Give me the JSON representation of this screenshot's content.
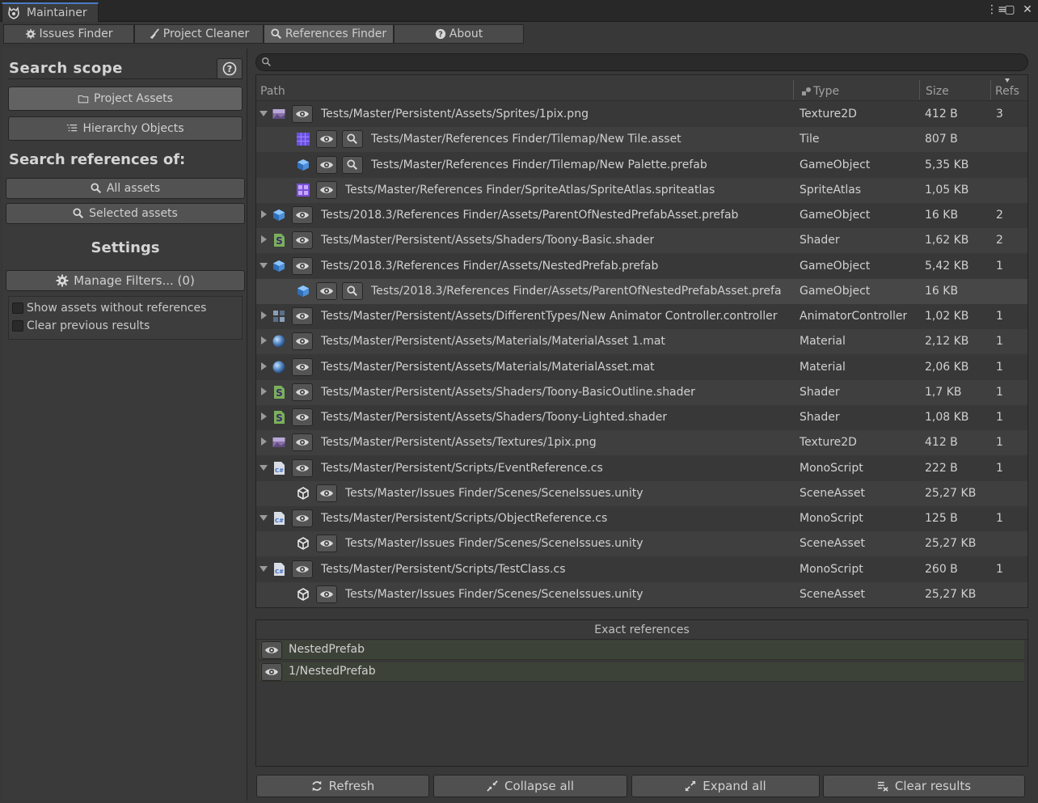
{
  "window": {
    "title": "Maintainer"
  },
  "tabs": [
    {
      "label": "Issues Finder",
      "icon": "bug-gear-icon"
    },
    {
      "label": "Project Cleaner",
      "icon": "broom-icon"
    },
    {
      "label": "References Finder",
      "icon": "search-icon",
      "active": true
    },
    {
      "label": "About",
      "icon": "help-icon"
    }
  ],
  "left": {
    "search_scope_title": "Search scope",
    "project_assets": "Project Assets",
    "hierarchy_objects": "Hierarchy Objects",
    "search_refs_title": "Search references of:",
    "all_assets": "All assets",
    "selected_assets": "Selected assets",
    "settings_title": "Settings",
    "manage_filters": "Manage Filters... (0)",
    "opt_show_without_refs": "Show assets without references",
    "opt_clear_previous": "Clear previous results"
  },
  "search": {
    "value": "",
    "placeholder": ""
  },
  "table": {
    "headers": {
      "path": "Path",
      "type": "Type",
      "size": "Size",
      "refs": "Refs"
    },
    "rows": [
      {
        "path": "Tests/Master/Persistent/Assets/Sprites/1pix.png",
        "type": "Texture2D",
        "size": "412 B",
        "refs": "3",
        "level": 0,
        "expand": "open",
        "icon": "texture-icon",
        "mag": false
      },
      {
        "path": "Tests/Master/References Finder/Tilemap/New Tile.asset",
        "type": "Tile",
        "size": "807 B",
        "refs": "",
        "level": 1,
        "expand": "none",
        "icon": "tile-icon",
        "mag": true
      },
      {
        "path": "Tests/Master/References Finder/Tilemap/New Palette.prefab",
        "type": "GameObject",
        "size": "5,35 KB",
        "refs": "",
        "level": 1,
        "expand": "none",
        "icon": "prefab-icon",
        "mag": true
      },
      {
        "path": "Tests/Master/References Finder/SpriteAtlas/SpriteAtlas.spriteatlas",
        "type": "SpriteAtlas",
        "size": "1,05 KB",
        "refs": "",
        "level": 1,
        "expand": "none",
        "icon": "sprite-atlas-icon",
        "mag": false
      },
      {
        "path": "Tests/2018.3/References Finder/Assets/ParentOfNestedPrefabAsset.prefab",
        "type": "GameObject",
        "size": "16 KB",
        "refs": "2",
        "level": 0,
        "expand": "closed",
        "icon": "prefab-icon",
        "mag": false
      },
      {
        "path": "Tests/Master/Persistent/Assets/Shaders/Toony-Basic.shader",
        "type": "Shader",
        "size": "1,62 KB",
        "refs": "2",
        "level": 0,
        "expand": "closed",
        "icon": "shader-icon",
        "mag": false
      },
      {
        "path": "Tests/2018.3/References Finder/Assets/NestedPrefab.prefab",
        "type": "GameObject",
        "size": "5,42 KB",
        "refs": "1",
        "level": 0,
        "expand": "open",
        "icon": "prefab-icon",
        "mag": false
      },
      {
        "path": "Tests/2018.3/References Finder/Assets/ParentOfNestedPrefabAsset.prefa",
        "type": "GameObject",
        "size": "16 KB",
        "refs": "",
        "level": 1,
        "expand": "none",
        "icon": "prefab-icon",
        "mag": true,
        "selected": true
      },
      {
        "path": "Tests/Master/Persistent/Assets/DifferentTypes/New Animator Controller.controller",
        "type": "AnimatorController",
        "size": "1,02 KB",
        "refs": "1",
        "level": 0,
        "expand": "closed",
        "icon": "animator-icon",
        "mag": false
      },
      {
        "path": "Tests/Master/Persistent/Assets/Materials/MaterialAsset 1.mat",
        "type": "Material",
        "size": "2,12 KB",
        "refs": "1",
        "level": 0,
        "expand": "closed",
        "icon": "material-icon",
        "mag": false
      },
      {
        "path": "Tests/Master/Persistent/Assets/Materials/MaterialAsset.mat",
        "type": "Material",
        "size": "2,06 KB",
        "refs": "1",
        "level": 0,
        "expand": "closed",
        "icon": "material-icon",
        "mag": false
      },
      {
        "path": "Tests/Master/Persistent/Assets/Shaders/Toony-BasicOutline.shader",
        "type": "Shader",
        "size": "1,7 KB",
        "refs": "1",
        "level": 0,
        "expand": "closed",
        "icon": "shader-icon",
        "mag": false
      },
      {
        "path": "Tests/Master/Persistent/Assets/Shaders/Toony-Lighted.shader",
        "type": "Shader",
        "size": "1,08 KB",
        "refs": "1",
        "level": 0,
        "expand": "closed",
        "icon": "shader-icon",
        "mag": false
      },
      {
        "path": "Tests/Master/Persistent/Assets/Textures/1pix.png",
        "type": "Texture2D",
        "size": "412 B",
        "refs": "1",
        "level": 0,
        "expand": "closed",
        "icon": "texture-icon",
        "mag": false
      },
      {
        "path": "Tests/Master/Persistent/Scripts/EventReference.cs",
        "type": "MonoScript",
        "size": "222 B",
        "refs": "1",
        "level": 0,
        "expand": "open",
        "icon": "csharp-script-icon",
        "mag": false
      },
      {
        "path": "Tests/Master/Issues Finder/Scenes/SceneIssues.unity",
        "type": "SceneAsset",
        "size": "25,27 KB",
        "refs": "",
        "level": 1,
        "expand": "none",
        "icon": "unity-scene-icon",
        "mag": false
      },
      {
        "path": "Tests/Master/Persistent/Scripts/ObjectReference.cs",
        "type": "MonoScript",
        "size": "125 B",
        "refs": "1",
        "level": 0,
        "expand": "open",
        "icon": "csharp-script-icon",
        "mag": false
      },
      {
        "path": "Tests/Master/Issues Finder/Scenes/SceneIssues.unity",
        "type": "SceneAsset",
        "size": "25,27 KB",
        "refs": "",
        "level": 1,
        "expand": "none",
        "icon": "unity-scene-icon",
        "mag": false
      },
      {
        "path": "Tests/Master/Persistent/Scripts/TestClass.cs",
        "type": "MonoScript",
        "size": "260 B",
        "refs": "1",
        "level": 0,
        "expand": "open",
        "icon": "csharp-script-icon",
        "mag": false
      },
      {
        "path": "Tests/Master/Issues Finder/Scenes/SceneIssues.unity",
        "type": "SceneAsset",
        "size": "25,27 KB",
        "refs": "",
        "level": 1,
        "expand": "none",
        "icon": "unity-scene-icon",
        "mag": false
      }
    ]
  },
  "exact_refs": {
    "title": "Exact references",
    "items": [
      "NestedPrefab",
      "1/NestedPrefab"
    ]
  },
  "bottom": {
    "refresh": "Refresh",
    "collapse_all": "Collapse all",
    "expand_all": "Expand all",
    "clear_results": "Clear results"
  },
  "colors": {
    "accent": "#4a7bc4",
    "bg": "#383838",
    "button": "#525252"
  }
}
